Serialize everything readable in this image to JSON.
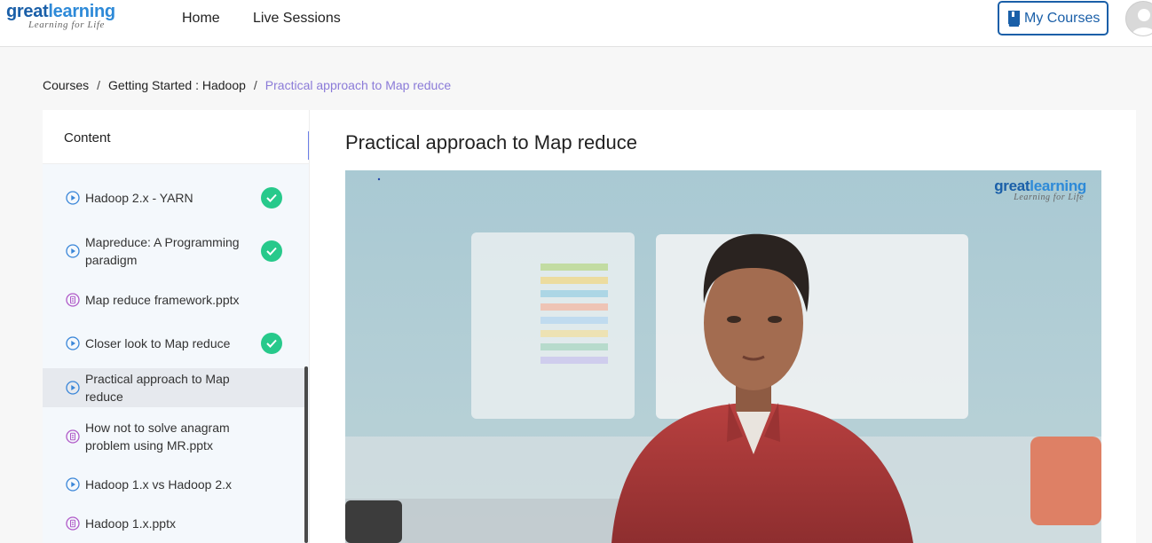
{
  "brand": {
    "name_part1": "great",
    "name_part2": "learning",
    "tagline": "Learning for Life"
  },
  "nav": {
    "home": "Home",
    "live_sessions": "Live Sessions",
    "my_courses": "My Courses"
  },
  "breadcrumb": {
    "courses": "Courses",
    "sep": "/",
    "course": "Getting Started : Hadoop",
    "current": "Practical approach to Map reduce"
  },
  "sidebar": {
    "title": "Content",
    "items": [
      {
        "label": "Hadoop 2.x - YARN",
        "type": "video",
        "done": true
      },
      {
        "label": "Mapreduce: A Programming paradigm",
        "type": "video",
        "done": true
      },
      {
        "label": "Map reduce framework.pptx",
        "type": "document",
        "done": false
      },
      {
        "label": "Closer look to Map reduce",
        "type": "video",
        "done": true
      },
      {
        "label": "Practical approach to Map reduce",
        "type": "video",
        "done": false,
        "active": true
      },
      {
        "label": "How not to solve anagram problem using MR.pptx",
        "type": "document",
        "done": false
      },
      {
        "label": "Hadoop 1.x vs Hadoop 2.x",
        "type": "video",
        "done": false
      },
      {
        "label": "Hadoop 1.x.pptx",
        "type": "document",
        "done": false
      }
    ]
  },
  "collapse": {
    "glyph": "«"
  },
  "main": {
    "title": "Practical approach to Map reduce"
  },
  "video": {
    "watermark_part1": "great",
    "watermark_part2": "learning",
    "watermark_tagline": "Learning for Life"
  },
  "colors": {
    "brand_blue": "#1a5fa8",
    "accent_purple": "#8b7bd8",
    "check_green": "#27c98b",
    "collapse_blue": "#6b7fe8"
  }
}
